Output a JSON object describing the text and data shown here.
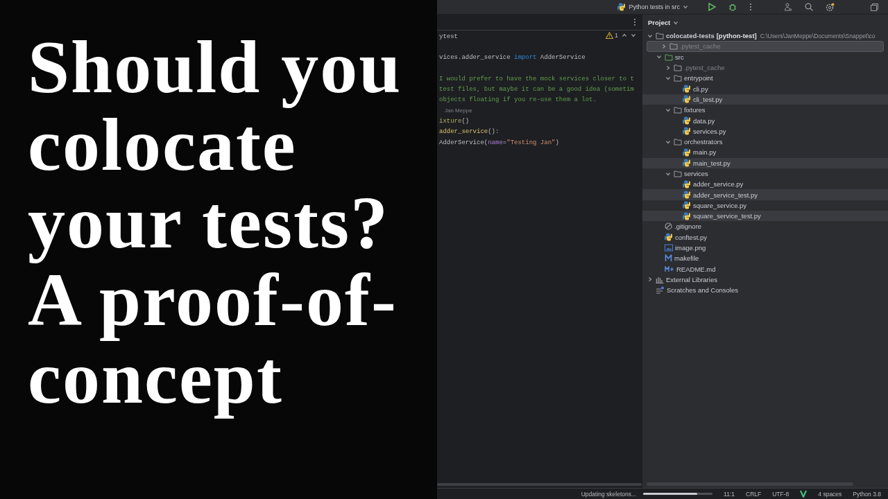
{
  "title_card": {
    "title": "Should you colocate your tests? A proof-of-concept"
  },
  "top_bar": {
    "run_config": "Python tests in src"
  },
  "editor": {
    "inspection": {
      "warnings": "1"
    },
    "lines": [
      {
        "kind": "code",
        "tokens": [
          {
            "text": "ytest",
            "kind": "plain"
          }
        ]
      },
      {
        "kind": "blank"
      },
      {
        "kind": "code",
        "tokens": [
          {
            "text": "vices.adder_service ",
            "kind": "plain"
          },
          {
            "text": "import",
            "kind": "keyword"
          },
          {
            "text": " AdderService",
            "kind": "plain"
          }
        ]
      },
      {
        "kind": "blank"
      },
      {
        "kind": "code",
        "tokens": [
          {
            "text": "I would prefer to have the mock services closer to t",
            "kind": "comment"
          }
        ]
      },
      {
        "kind": "code",
        "tokens": [
          {
            "text": "test files, but maybe it can be a good idea (sometim",
            "kind": "comment"
          }
        ]
      },
      {
        "kind": "code",
        "tokens": [
          {
            "text": "objects floating if you re-use them a lot.",
            "kind": "comment"
          }
        ]
      },
      {
        "kind": "inlay",
        "author": "Jan Meppe"
      },
      {
        "kind": "code",
        "tokens": [
          {
            "text": "ixture",
            "kind": "decorator"
          },
          {
            "text": "()",
            "kind": "plain"
          }
        ]
      },
      {
        "kind": "code",
        "tokens": [
          {
            "text": "adder_service",
            "kind": "function"
          },
          {
            "text": "():",
            "kind": "plain"
          }
        ]
      },
      {
        "kind": "code",
        "tokens": [
          {
            "text": "AdderService(",
            "kind": "plain"
          },
          {
            "text": "name",
            "kind": "param"
          },
          {
            "text": "=",
            "kind": "plain"
          },
          {
            "text": "\"Testing Jan\"",
            "kind": "string"
          },
          {
            "text": ")",
            "kind": "plain"
          }
        ]
      },
      {
        "kind": "blank"
      }
    ]
  },
  "project": {
    "title": "Project",
    "tree": [
      {
        "name": "colocated-tests",
        "module": "[python-test]",
        "path": "C:\\Users\\JanMeppe\\Documents\\Snappet\\co",
        "kind": "project",
        "expanded": true,
        "selected": false,
        "highlighted": false,
        "excluded": false,
        "children": [
          {
            "name": ".pytest_cache",
            "kind": "folder",
            "expanded": false,
            "selected": true,
            "highlighted": false,
            "excluded": true
          },
          {
            "name": "src",
            "kind": "source-folder",
            "expanded": true,
            "selected": false,
            "highlighted": false,
            "excluded": false,
            "children": [
              {
                "name": ".pytest_cache",
                "kind": "folder",
                "expanded": false,
                "selected": false,
                "highlighted": false,
                "excluded": true
              },
              {
                "name": "entrypoint",
                "kind": "folder",
                "expanded": true,
                "selected": false,
                "highlighted": false,
                "excluded": false,
                "children": [
                  {
                    "name": "cli.py",
                    "kind": "python",
                    "selected": false,
                    "highlighted": false,
                    "excluded": false
                  },
                  {
                    "name": "cli_test.py",
                    "kind": "python",
                    "selected": false,
                    "highlighted": true,
                    "excluded": false
                  }
                ]
              },
              {
                "name": "fixtures",
                "kind": "folder",
                "expanded": true,
                "selected": false,
                "highlighted": false,
                "excluded": false,
                "children": [
                  {
                    "name": "data.py",
                    "kind": "python",
                    "selected": false,
                    "highlighted": false,
                    "excluded": false
                  },
                  {
                    "name": "services.py",
                    "kind": "python",
                    "selected": false,
                    "highlighted": false,
                    "excluded": false
                  }
                ]
              },
              {
                "name": "orchestrators",
                "kind": "folder",
                "expanded": true,
                "selected": false,
                "highlighted": false,
                "excluded": false,
                "children": [
                  {
                    "name": "main.py",
                    "kind": "python",
                    "selected": false,
                    "highlighted": false,
                    "excluded": false
                  },
                  {
                    "name": "main_test.py",
                    "kind": "python",
                    "selected": false,
                    "highlighted": true,
                    "excluded": false
                  }
                ]
              },
              {
                "name": "services",
                "kind": "folder",
                "expanded": true,
                "selected": false,
                "highlighted": false,
                "excluded": false,
                "children": [
                  {
                    "name": "adder_service.py",
                    "kind": "python",
                    "selected": false,
                    "highlighted": false,
                    "excluded": false
                  },
                  {
                    "name": "adder_service_test.py",
                    "kind": "python",
                    "selected": false,
                    "highlighted": true,
                    "excluded": false
                  },
                  {
                    "name": "square_service.py",
                    "kind": "python",
                    "selected": false,
                    "highlighted": false,
                    "excluded": false
                  },
                  {
                    "name": "square_service_test.py",
                    "kind": "python",
                    "selected": false,
                    "highlighted": true,
                    "excluded": false
                  }
                ]
              }
            ]
          },
          {
            "name": ".gitignore",
            "kind": "gitignore",
            "selected": false,
            "highlighted": false,
            "excluded": false
          },
          {
            "name": "conftest.py",
            "kind": "python",
            "selected": false,
            "highlighted": false,
            "excluded": false
          },
          {
            "name": "image.png",
            "kind": "image",
            "selected": false,
            "highlighted": false,
            "excluded": false
          },
          {
            "name": "makefile",
            "kind": "makefile",
            "selected": false,
            "highlighted": false,
            "excluded": false
          },
          {
            "name": "README.md",
            "kind": "markdown",
            "selected": false,
            "highlighted": false,
            "excluded": false
          }
        ]
      },
      {
        "name": "External Libraries",
        "kind": "libraries",
        "expanded": false,
        "selected": false,
        "highlighted": false,
        "excluded": false
      },
      {
        "name": "Scratches and Consoles",
        "kind": "scratches",
        "selected": false,
        "highlighted": false,
        "excluded": false
      }
    ]
  },
  "status_bar": {
    "task": "Updating skeletons...",
    "progress": {
      "level": 0.78
    },
    "position": "11:1",
    "line_separator": "CRLF",
    "encoding": "UTF-8",
    "indent": "4 spaces",
    "interpreter": "Python 3.8"
  }
}
